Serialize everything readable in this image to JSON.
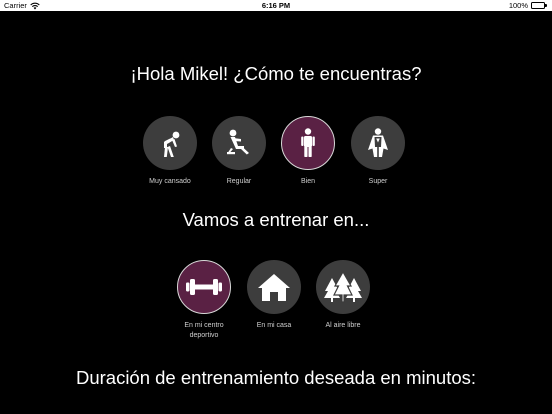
{
  "status_bar": {
    "carrier": "Carrier",
    "time": "6:16 PM",
    "battery_percent": "100%",
    "battery_level": 1.0
  },
  "greeting": "¡Hola Mikel! ¿Cómo te encuentras?",
  "mood_options": [
    {
      "label": "Muy cansado",
      "icon": "tired-person-icon",
      "selected": false
    },
    {
      "label": "Regular",
      "icon": "sitting-person-icon",
      "selected": false
    },
    {
      "label": "Bien",
      "icon": "standing-person-icon",
      "selected": true
    },
    {
      "label": "Super",
      "icon": "superhero-icon",
      "selected": false
    }
  ],
  "train_heading": "Vamos a entrenar en...",
  "location_options": [
    {
      "label": "En mi centro deportivo",
      "icon": "dumbbell-icon",
      "selected": true
    },
    {
      "label": "En mi casa",
      "icon": "house-icon",
      "selected": false
    },
    {
      "label": "Al aire libre",
      "icon": "trees-icon",
      "selected": false
    }
  ],
  "duration_heading": "Duración de entrenamiento deseada en minutos:",
  "colors": {
    "background": "#000000",
    "option_circle": "#3d3d3d",
    "selected_circle": "#5a2144",
    "text": "#ffffff",
    "label": "#cfcfcf"
  }
}
